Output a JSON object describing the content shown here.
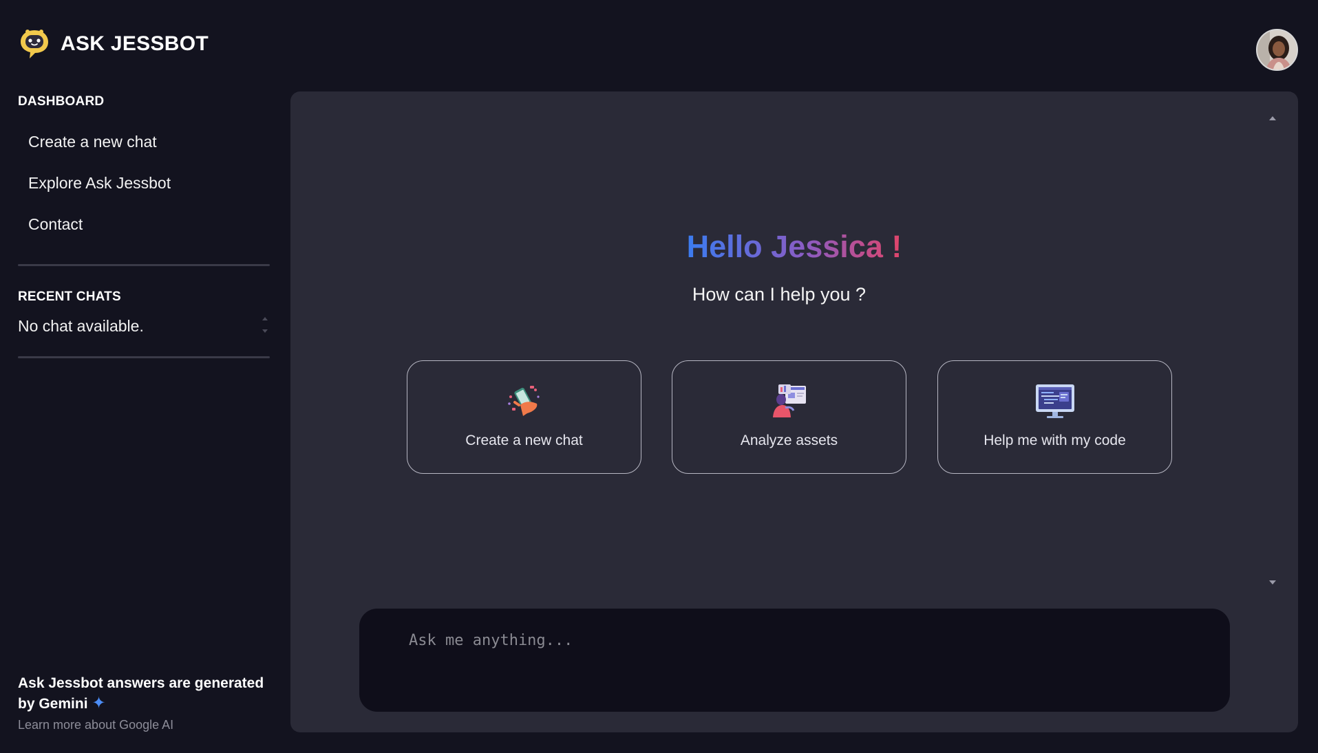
{
  "app": {
    "brand": "ASK JESSBOT",
    "logo_icon": "bot-chat-icon",
    "avatar_icon": "user-avatar"
  },
  "sidebar": {
    "dashboard_title": "DASHBOARD",
    "nav_items": [
      {
        "label": "Create a new chat"
      },
      {
        "label": "Explore Ask Jessbot"
      },
      {
        "label": "Contact"
      }
    ],
    "recent_title": "RECENT CHATS",
    "recent_empty": "No chat available.",
    "footer": {
      "generated_text": "Ask Jessbot answers are generated by Gemini",
      "sparkle_icon": "sparkle-icon",
      "learn_more": "Learn more about Google AI"
    }
  },
  "main": {
    "greeting": "Hello Jessica !",
    "subgreeting": "How can I help you ?",
    "cards": [
      {
        "label": "Create a new chat",
        "icon": "chat-phone-icon"
      },
      {
        "label": "Analyze assets",
        "icon": "analyze-chart-icon"
      },
      {
        "label": "Help me with my code",
        "icon": "code-monitor-icon"
      }
    ],
    "input": {
      "placeholder": "Ask me anything...",
      "value": ""
    }
  },
  "colors": {
    "background": "#13131f",
    "panel": "#2a2a37",
    "input_bg": "#0f0e1a",
    "gradient_start": "#3b7cf0",
    "gradient_mid": "#8a5cc4",
    "gradient_end": "#e0456a",
    "logo_yellow": "#f2c94c",
    "sparkle_blue": "#4c8df6"
  }
}
